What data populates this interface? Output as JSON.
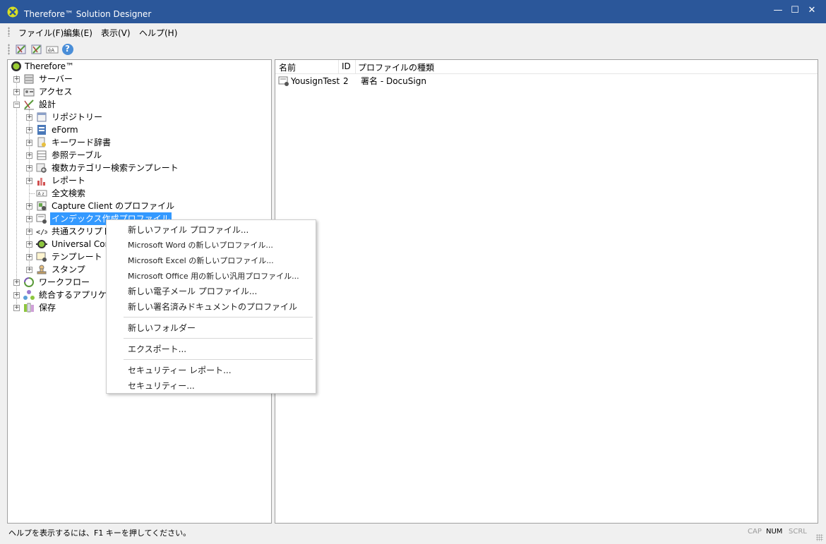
{
  "window": {
    "title": "Therefore™ Solution Designer",
    "controls": {
      "minimize": "—",
      "maximize": "☐",
      "close": "✕"
    }
  },
  "menu": [
    {
      "label": "ファイル(F)"
    },
    {
      "label": "編集(E)"
    },
    {
      "label": "表示(V)"
    },
    {
      "label": "ヘルプ(H)"
    }
  ],
  "toolbar": {
    "buttons": [
      "design-tool-icon",
      "design-check-icon",
      "text-search-icon",
      "help-icon"
    ],
    "help_glyph": "?"
  },
  "tree": {
    "root": "Therefore™",
    "server": "サーバー",
    "access": "アクセス",
    "design": "設計",
    "design_children": {
      "repository": "リポジトリー",
      "eform": "eForm",
      "keyword": "キーワード辞書",
      "reference_table": "参照テーブル",
      "multi_category": "複数カテゴリー検索テンプレート",
      "report": "レポート",
      "fulltext": "全文検索",
      "capture": "Capture Client のプロファイル",
      "index_profile": "インデックス作成プロファイル",
      "common_script": "共通スクリプト",
      "universal": "Universal Conn",
      "template": "テンプレート プロ",
      "stamp": "スタンプ"
    },
    "workflow": "ワークフロー",
    "integrate": "統合するアプリケー",
    "storage": "保存"
  },
  "list": {
    "columns": {
      "name": "名前",
      "id": "ID",
      "type": "プロファイルの種類"
    },
    "rows": [
      {
        "name": "YousignTest",
        "id": "2",
        "type": "署名 - DocuSign"
      }
    ]
  },
  "context_menu": {
    "new_file_profile": "新しいファイル プロファイル...",
    "new_word_profile": "Microsoft Word の新しいプロファイル...",
    "new_excel_profile": "Microsoft Excel の新しいプロファイル...",
    "new_office_profile": "Microsoft Office 用の新しい汎用プロファイル...",
    "new_email_profile": "新しい電子メール プロファイル...",
    "new_signed_doc_profile": "新しい署名済みドキュメントのプロファイル",
    "new_folder": "新しいフォルダー",
    "export": "エクスポート...",
    "security_report": "セキュリティー レポート...",
    "security": "セキュリティー..."
  },
  "status": {
    "help": "ヘルプを表示するには、F1 キーを押してください。",
    "cap": "CAP",
    "num": "NUM",
    "scrl": "SCRL"
  }
}
